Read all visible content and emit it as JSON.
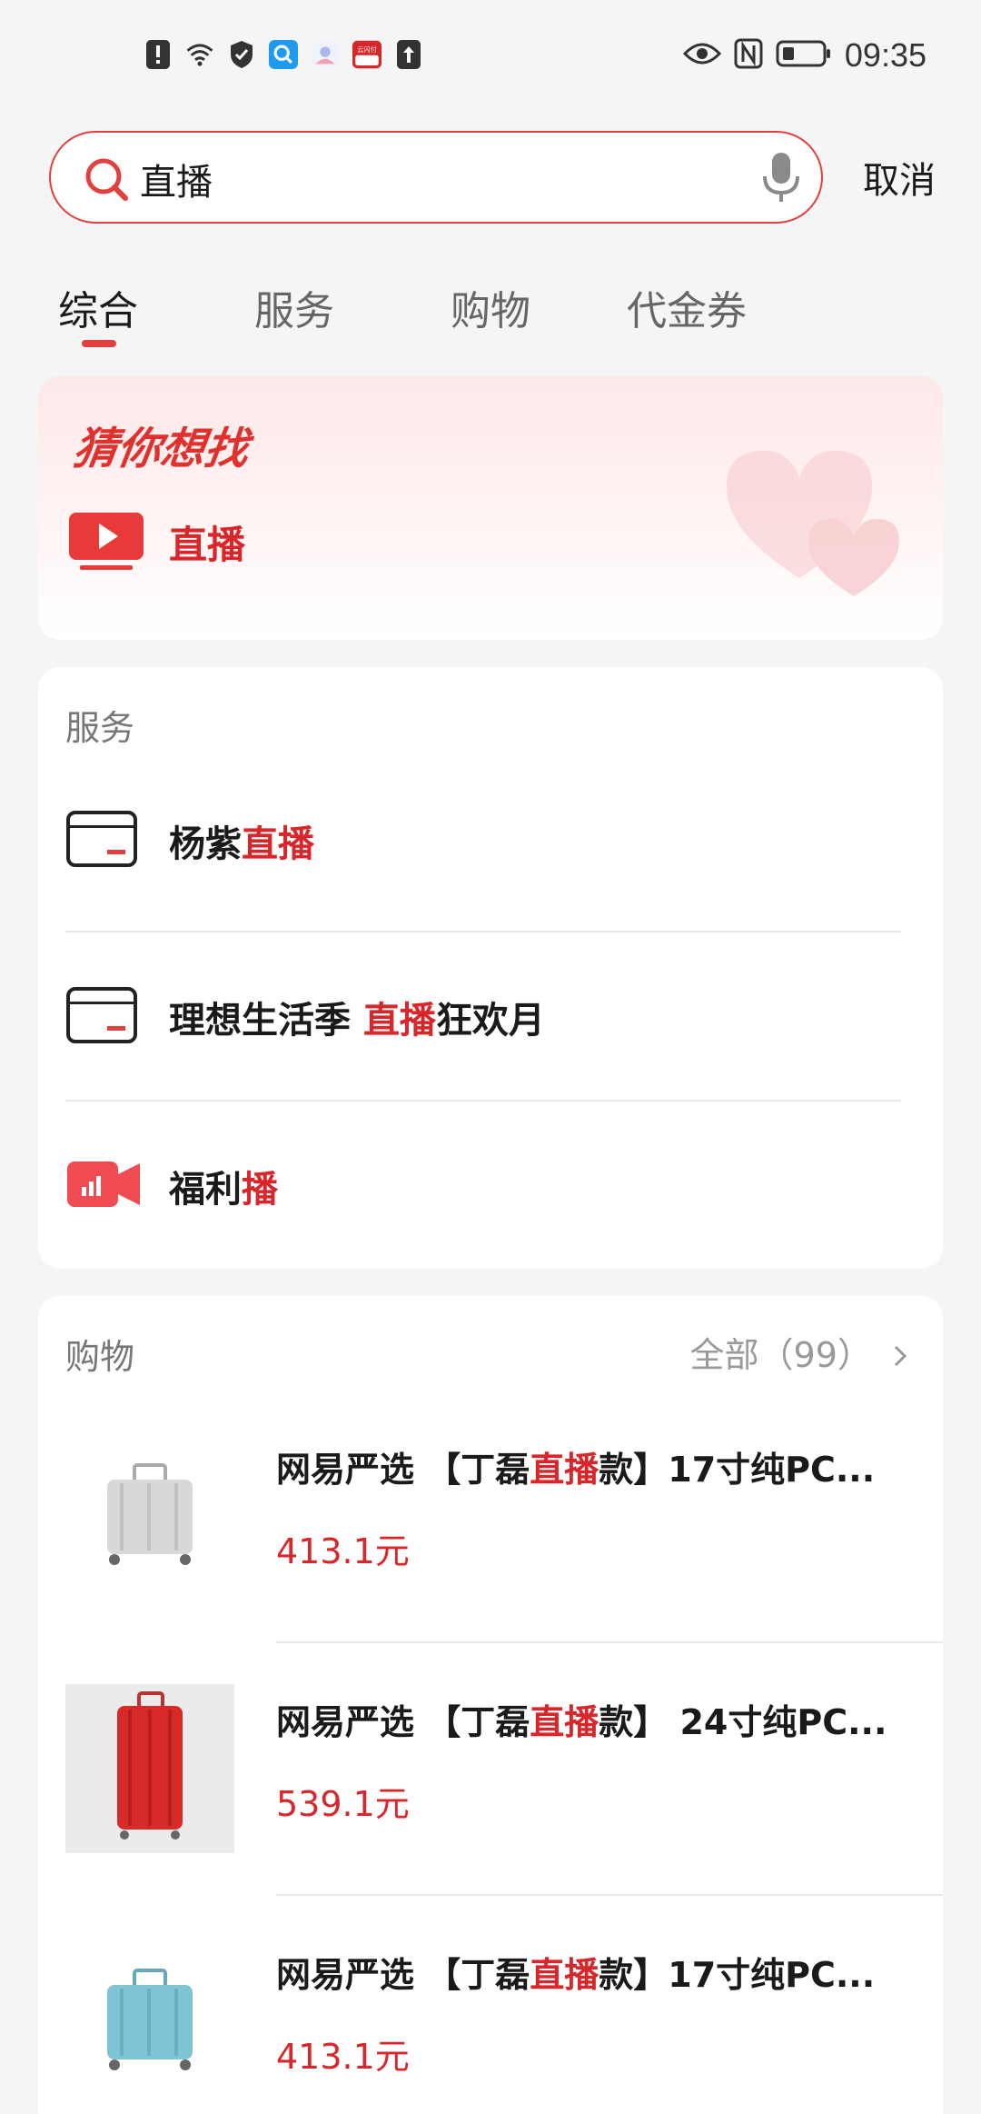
{
  "status_bar": {
    "time": "09:35",
    "pay_app_label": "云闪付"
  },
  "search": {
    "query": "直播",
    "cancel_label": "取消"
  },
  "tabs": [
    {
      "label": "综合",
      "active": true
    },
    {
      "label": "服务",
      "active": false
    },
    {
      "label": "购物",
      "active": false
    },
    {
      "label": "代金券",
      "active": false
    }
  ],
  "guess": {
    "title": "猜你想找",
    "item_label": "直播"
  },
  "services": {
    "title": "服务",
    "items": [
      {
        "prefix": "杨紫",
        "highlight": "直播",
        "suffix": "",
        "icon": "card-icon"
      },
      {
        "prefix": "理想生活季 ",
        "highlight": "直播",
        "suffix": "狂欢月",
        "icon": "card-icon"
      },
      {
        "prefix": "福利",
        "highlight": "播",
        "suffix": "",
        "icon": "video-camera-icon"
      }
    ]
  },
  "shopping": {
    "title": "购物",
    "more_label": "全部（99）",
    "products": [
      {
        "brand": "网易严选 【丁磊",
        "highlight": "直播",
        "suffix": "款】17寸纯PC...",
        "price": "413.1元",
        "color": "#d8d8d8"
      },
      {
        "brand": "网易严选 【丁磊",
        "highlight": "直播",
        "suffix": "款】 24寸纯PC...",
        "price": "539.1元",
        "color": "#d92a2a"
      },
      {
        "brand": "网易严选 【丁磊",
        "highlight": "直播",
        "suffix": "款】17寸纯PC...",
        "price": "413.1元",
        "color": "#7fc4d4"
      }
    ]
  },
  "colors": {
    "accent": "#e2403e",
    "highlight": "#d8262a",
    "background": "#f5f5f5"
  }
}
